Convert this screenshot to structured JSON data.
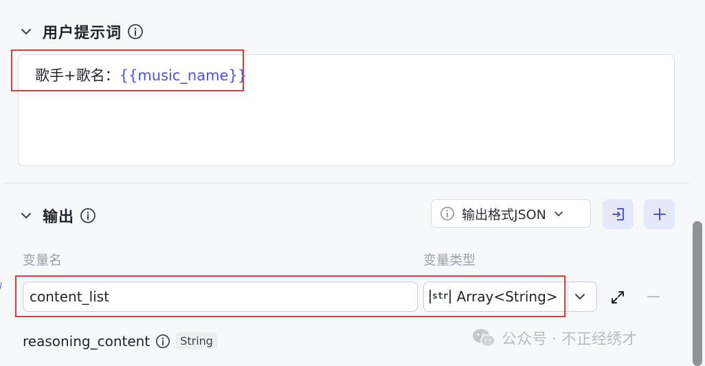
{
  "prompt_section": {
    "title": "用户提示词",
    "content_prefix": "歌手+歌名：",
    "content_variable": "{{music_name}}"
  },
  "output_section": {
    "title": "输出",
    "format_button_label": "输出格式JSON",
    "column_name_header": "变量名",
    "column_type_header": "变量类型",
    "rows": [
      {
        "name": "content_list",
        "type_icon": "str",
        "type": "Array<String>"
      },
      {
        "name": "reasoning_content",
        "type": "String"
      }
    ]
  },
  "watermark": "公众号 · 不正经绣才",
  "icons": {
    "collapse": "chevron-down-icon",
    "info": "info-icon",
    "import": "import-icon",
    "add": "plus-icon",
    "expand": "expand-icon",
    "remove": "minus-icon",
    "wechat": "wechat-icon"
  },
  "colors": {
    "accent": "#4d53e8",
    "highlight_box": "#e23b3b"
  }
}
